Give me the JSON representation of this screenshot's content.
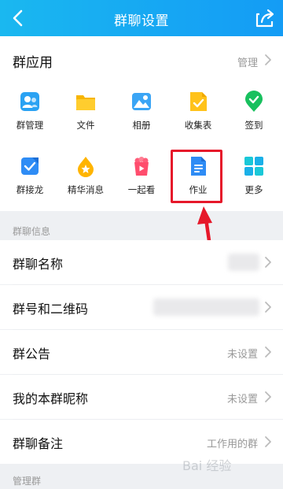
{
  "header": {
    "title": "群聊设置"
  },
  "apps": {
    "title": "群应用",
    "manage_label": "管理",
    "items": [
      {
        "label": "群管理",
        "icon": "group-manage-icon"
      },
      {
        "label": "文件",
        "icon": "folder-icon"
      },
      {
        "label": "相册",
        "icon": "photo-album-icon"
      },
      {
        "label": "收集表",
        "icon": "collect-form-icon"
      },
      {
        "label": "签到",
        "icon": "check-in-icon"
      },
      {
        "label": "群接龙",
        "icon": "relay-icon"
      },
      {
        "label": "精华消息",
        "icon": "essence-icon"
      },
      {
        "label": "一起看",
        "icon": "watch-together-icon"
      },
      {
        "label": "作业",
        "icon": "homework-icon"
      },
      {
        "label": "更多",
        "icon": "more-grid-icon"
      }
    ]
  },
  "info": {
    "section_title": "群聊信息",
    "rows": [
      {
        "label": "群聊名称",
        "value": ""
      },
      {
        "label": "群号和二维码",
        "value": ""
      },
      {
        "label": "群公告",
        "value": "未设置"
      },
      {
        "label": "我的本群昵称",
        "value": "未设置"
      },
      {
        "label": "群聊备注",
        "value": "工作用的群"
      }
    ]
  },
  "manage_section_title": "管理群",
  "watermark": "Bai 经验",
  "colors": {
    "header": "#16a6f3",
    "highlight": "#e6182a",
    "accent": "#1a8cff"
  }
}
